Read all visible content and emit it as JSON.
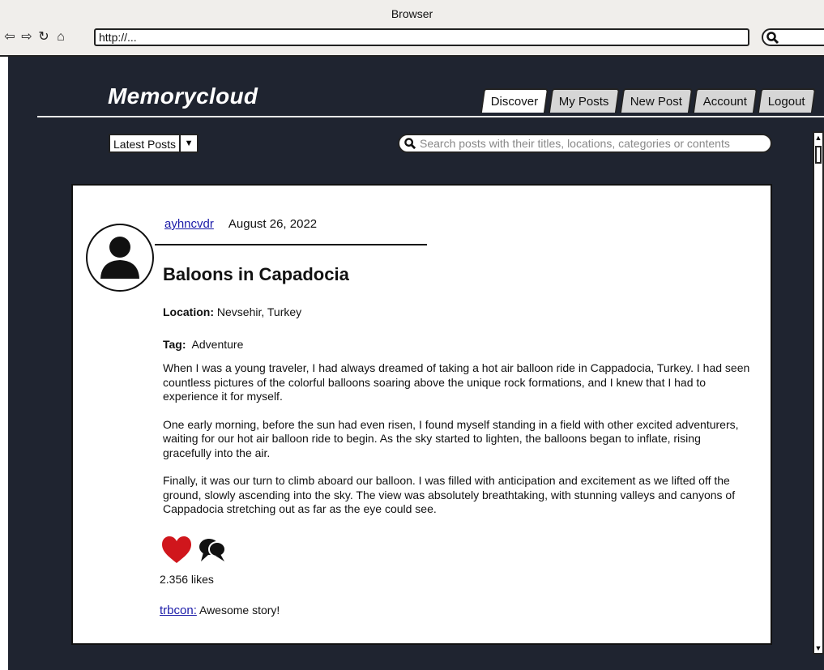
{
  "browser": {
    "title": "Browser",
    "url": "http://..."
  },
  "app": {
    "brand": "Memorycloud",
    "tabs": [
      {
        "label": "Discover",
        "active": true
      },
      {
        "label": "My Posts",
        "active": false
      },
      {
        "label": "New Post",
        "active": false
      },
      {
        "label": "Account",
        "active": false
      },
      {
        "label": "Logout",
        "active": false
      }
    ],
    "sort": {
      "selected": "Latest Posts"
    },
    "search": {
      "placeholder": "Search posts with their titles, locations, categories or contents"
    }
  },
  "post": {
    "author": "ayhncvdr",
    "date": "August 26, 2022",
    "title": "Baloons in Capadocia",
    "location_label": "Location:",
    "location": "Nevsehir, Turkey",
    "tag_label": "Tag:",
    "tag": "Adventure",
    "paragraphs": [
      "When I was a young traveler, I had always dreamed of taking a hot air balloon ride in Cappadocia, Turkey. I had seen countless pictures of the colorful balloons soaring above the unique rock formations, and I knew that I had to experience it for myself.",
      "One early morning, before the sun had even risen, I found myself standing in a field with other excited adventurers, waiting for our hot air balloon ride to begin. As the sky started to lighten, the balloons began to inflate, rising gracefully into the air.",
      "Finally, it was our turn to climb aboard our balloon. I was filled with anticipation and excitement as we lifted off the ground, slowly ascending into the sky. The view was absolutely breathtaking, with stunning valleys and canyons of Cappadocia stretching out as far as the eye could see."
    ],
    "likes": "2.356 likes",
    "comments": [
      {
        "user": "trbcon:",
        "text": "Awesome story!"
      }
    ]
  },
  "colors": {
    "background": "#1f2430",
    "like": "#d0161c",
    "link": "#1a1aa8"
  },
  "icons": [
    "back-icon",
    "forward-icon",
    "reload-icon",
    "home-icon",
    "search-icon",
    "user-avatar-icon",
    "heart-icon",
    "comments-icon"
  ]
}
